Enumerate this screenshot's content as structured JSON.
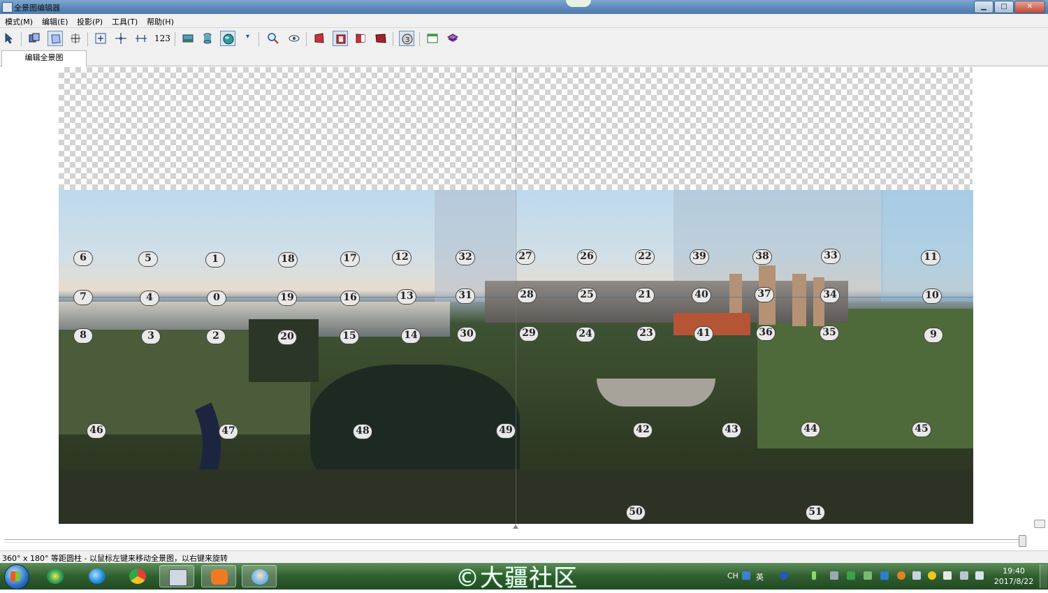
{
  "window": {
    "title": "全景图编辑器",
    "minimize": "▁",
    "maximize": "□",
    "close": "✕"
  },
  "menu": [
    {
      "label": "模式(M)"
    },
    {
      "label": "编辑(E)"
    },
    {
      "label": "投影(P)"
    },
    {
      "label": "工具(T)"
    },
    {
      "label": "帮助(H)"
    }
  ],
  "toolbar": {
    "numbers_label": "123",
    "dropdown_glyph": "▾",
    "icons": [
      "select-cursor-icon",
      "preview-icon",
      "edit-frames-icon",
      "crop-icon",
      "fit-icon",
      "center-icon",
      "straighten-icon",
      "image-icon",
      "cylinder-icon",
      "sphere-icon",
      "zoom-icon",
      "eye-icon",
      "box-left-icon",
      "box-center-icon",
      "box-right-icon",
      "box-dark-icon",
      "layer-3-icon",
      "window-icon",
      "stack-icon"
    ]
  },
  "tabs": [
    {
      "label": "编辑全景图",
      "active": true
    }
  ],
  "control_points": [
    "6",
    "5",
    "1",
    "18",
    "17",
    "12",
    "32",
    "27",
    "26",
    "22",
    "39",
    "38",
    "33",
    "11",
    "7",
    "4",
    "0",
    "19",
    "16",
    "13",
    "31",
    "28",
    "25",
    "21",
    "40",
    "37",
    "34",
    "10",
    "8",
    "3",
    "2",
    "20",
    "15",
    "14",
    "30",
    "29",
    "24",
    "23",
    "41",
    "36",
    "35",
    "9",
    "46",
    "47",
    "48",
    "49",
    "42",
    "43",
    "44",
    "45",
    "50",
    "51"
  ],
  "status": {
    "text": "360° x 180° 等距圆柱 - 以鼠标左键来移动全景图，以右键来旋转"
  },
  "watermark": "©大疆社区",
  "taskbar": {
    "apps": [
      "start-button",
      "app-360-icon",
      "ie-icon",
      "chrome-icon",
      "panorama-editor-app",
      "app-orange-icon",
      "app-avatar-icon"
    ],
    "tray": {
      "lang": "CH",
      "ime": "英",
      "time": "19:40",
      "date": "2017/8/22"
    }
  },
  "colors": {
    "titlebar": "#5b86b8",
    "taskbar": "#2f5f2e",
    "control_point_fill": "#e9e9e9",
    "control_point_border": "#444444"
  }
}
